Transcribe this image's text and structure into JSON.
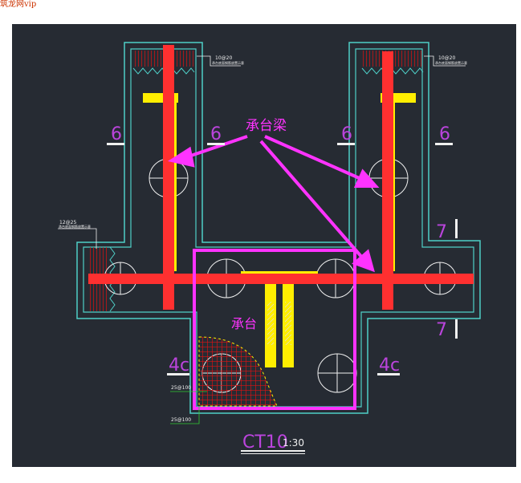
{
  "watermark": "筑龙网vip",
  "drawing": {
    "background": "#262b33",
    "colors": {
      "outline": "#4fd0c8",
      "beam": "#ff3030",
      "yellow": "#ffee00",
      "magenta": "#ff33ff",
      "hatch": "#dd1111",
      "white": "#f0f0f0",
      "green": "#33cc33",
      "purple": "#bb44dd"
    },
    "labels": {
      "beam_callout": "承台梁",
      "cap_callout": "承台",
      "section_6": "6",
      "section_7": "7",
      "section_4c": "4c",
      "rebar_top_left": "10@20",
      "rebar_top_right": "10@20",
      "rebar_side": "12@25",
      "rebar_note": "承台底面钢筋放置示意",
      "rebar_bottom_1": "25@100",
      "rebar_bottom_2": "25@100",
      "title": "CT10",
      "scale": "1:30"
    }
  }
}
